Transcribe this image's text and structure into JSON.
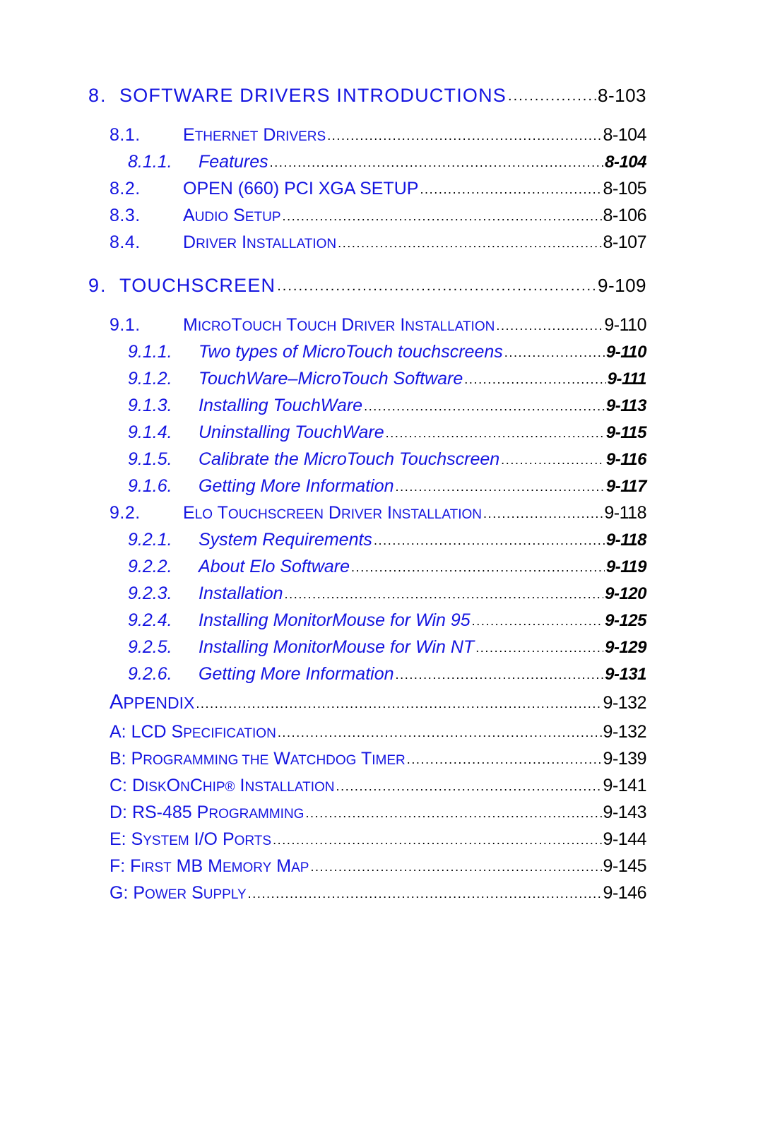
{
  "document": {
    "type": "table-of-contents",
    "text_color": "#1414e0",
    "page_number_color": "#000000",
    "background": "#ffffff"
  },
  "entries": [
    {
      "level": 1,
      "number": "8.",
      "title": "SOFTWARE DRIVERS INTRODUCTIONS",
      "page": "8-103"
    },
    {
      "level": 2,
      "number": "8.1.",
      "title": "ETHERNET DRIVERS",
      "page": "8-104"
    },
    {
      "level": 3,
      "number": "8.1.1.",
      "title": "Features",
      "page": "8-104"
    },
    {
      "level": 2,
      "number": "8.2.",
      "title": "OPEN (660) PCI XGA SETUP",
      "page": "8-105"
    },
    {
      "level": 2,
      "number": "8.3.",
      "title": "AUDIO SETUP",
      "page": "8-106"
    },
    {
      "level": 2,
      "number": "8.4.",
      "title": "DRIVER INSTALLATION",
      "page": "8-107"
    },
    {
      "level": 1,
      "number": "9.",
      "title": "TOUCHSCREEN",
      "page": "9-109"
    },
    {
      "level": 2,
      "number": "9.1.",
      "title": "MICROTOUCH TOUCH DRIVER INSTALLATION",
      "page": "9-110"
    },
    {
      "level": 3,
      "number": "9.1.1.",
      "title": "Two types of MicroTouch touchscreens",
      "page": "9-110"
    },
    {
      "level": 3,
      "number": "9.1.2.",
      "title": "TouchWare–MicroTouch Software",
      "page": "9-111"
    },
    {
      "level": 3,
      "number": "9.1.3.",
      "title": "Installing TouchWare",
      "page": "9-113"
    },
    {
      "level": 3,
      "number": "9.1.4.",
      "title": "Uninstalling TouchWare",
      "page": "9-115"
    },
    {
      "level": 3,
      "number": "9.1.5.",
      "title": "Calibrate the MicroTouch Touchscreen",
      "page": "9-116"
    },
    {
      "level": 3,
      "number": "9.1.6.",
      "title": "Getting More Information",
      "page": "9-117"
    },
    {
      "level": 2,
      "number": "9.2.",
      "title": "ELO TOUCHSCREEN DRIVER INSTALLATION",
      "page": "9-118"
    },
    {
      "level": 3,
      "number": "9.2.1.",
      "title": "System Requirements",
      "page": "9-118"
    },
    {
      "level": 3,
      "number": "9.2.2.",
      "title": "About Elo Software",
      "page": "9-119"
    },
    {
      "level": 3,
      "number": "9.2.3.",
      "title": "Installation",
      "page": "9-120"
    },
    {
      "level": 3,
      "number": "9.2.4.",
      "title": "Installing MonitorMouse for Win 95",
      "page": "9-125"
    },
    {
      "level": 3,
      "number": "9.2.5.",
      "title": "Installing MonitorMouse for Win NT",
      "page": "9-129"
    },
    {
      "level": 3,
      "number": "9.2.6.",
      "title": "Getting More Information",
      "page": "9-131"
    }
  ],
  "appendix": {
    "heading": {
      "title": "APPENDIX",
      "page": "9-132"
    },
    "items": [
      {
        "title": "A: LCD SPECIFICATION",
        "page": "9-132"
      },
      {
        "title": "B: PROGRAMMING THE WATCHDOG TIMER",
        "page": "9-139"
      },
      {
        "title": "C: DISKONCHIP® INSTALLATION",
        "page": "9-141"
      },
      {
        "title": "D: RS-485 PROGRAMMING",
        "page": "9-143"
      },
      {
        "title": "E: SYSTEM I/O PORTS",
        "page": "9-144"
      },
      {
        "title": "F: FIRST MB MEMORY MAP",
        "page": "9-145"
      },
      {
        "title": "G: POWER SUPPLY",
        "page": "9-146"
      }
    ]
  }
}
